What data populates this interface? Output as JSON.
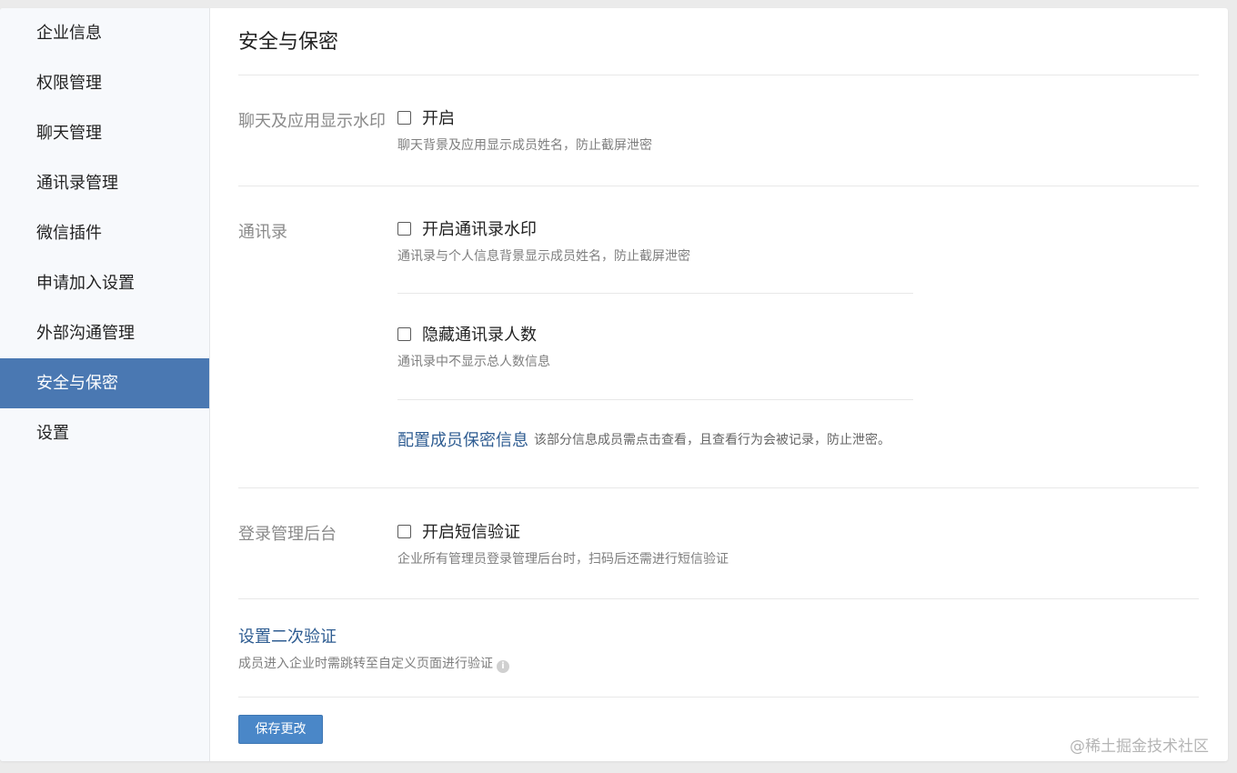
{
  "sidebar": {
    "items": [
      {
        "label": "企业信息"
      },
      {
        "label": "权限管理"
      },
      {
        "label": "聊天管理"
      },
      {
        "label": "通讯录管理"
      },
      {
        "label": "微信插件"
      },
      {
        "label": "申请加入设置"
      },
      {
        "label": "外部沟通管理"
      },
      {
        "label": "安全与保密",
        "active": true
      },
      {
        "label": "设置"
      }
    ]
  },
  "page": {
    "title": "安全与保密"
  },
  "watermark_section": {
    "label": "聊天及应用显示水印",
    "option": {
      "label": "开启",
      "checked": false,
      "desc": "聊天背景及应用显示成员姓名，防止截屏泄密"
    }
  },
  "contacts_section": {
    "label": "通讯录",
    "options": [
      {
        "label": "开启通讯录水印",
        "checked": false,
        "desc": "通讯录与个人信息背景显示成员姓名，防止截屏泄密"
      },
      {
        "label": "隐藏通讯录人数",
        "checked": false,
        "desc": "通讯录中不显示总人数信息"
      }
    ],
    "link": "配置成员保密信息",
    "link_note": "该部分信息成员需点击查看，且查看行为会被记录，防止泄密。"
  },
  "login_section": {
    "label": "登录管理后台",
    "option": {
      "label": "开启短信验证",
      "checked": false,
      "desc": "企业所有管理员登录管理后台时，扫码后还需进行短信验证"
    }
  },
  "secondary_verify": {
    "link": "设置二次验证",
    "desc": "成员进入企业时需跳转至自定义页面进行验证",
    "info_icon": "i"
  },
  "actions": {
    "save_label": "保存更改"
  },
  "watermark_text": "@稀土掘金技术社区",
  "colors": {
    "accent": "#4a78b2",
    "button": "#4a87c8",
    "link": "#2f5d92"
  }
}
